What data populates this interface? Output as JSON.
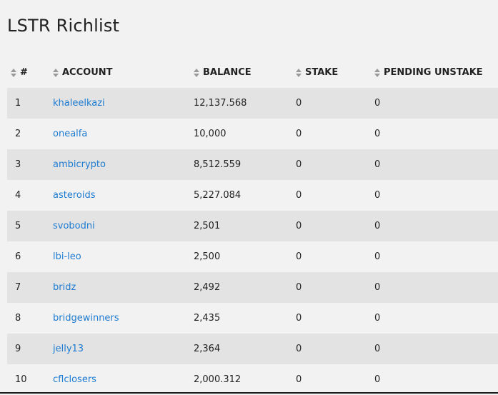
{
  "page": {
    "title": "LSTR Richlist"
  },
  "table": {
    "headers": [
      "#",
      "ACCOUNT",
      "BALANCE",
      "STAKE",
      "PENDING UNSTAKE"
    ],
    "rows": [
      {
        "rank": "1",
        "account": "khaleelkazi",
        "balance": "12,137.568",
        "stake": "0",
        "pending": "0"
      },
      {
        "rank": "2",
        "account": "onealfa",
        "balance": "10,000",
        "stake": "0",
        "pending": "0"
      },
      {
        "rank": "3",
        "account": "ambicrypto",
        "balance": "8,512.559",
        "stake": "0",
        "pending": "0"
      },
      {
        "rank": "4",
        "account": "asteroids",
        "balance": "5,227.084",
        "stake": "0",
        "pending": "0"
      },
      {
        "rank": "5",
        "account": "svobodni",
        "balance": "2,501",
        "stake": "0",
        "pending": "0"
      },
      {
        "rank": "6",
        "account": "lbi-leo",
        "balance": "2,500",
        "stake": "0",
        "pending": "0"
      },
      {
        "rank": "7",
        "account": "bridz",
        "balance": "2,492",
        "stake": "0",
        "pending": "0"
      },
      {
        "rank": "8",
        "account": "bridgewinners",
        "balance": "2,435",
        "stake": "0",
        "pending": "0"
      },
      {
        "rank": "9",
        "account": "jelly13",
        "balance": "2,364",
        "stake": "0",
        "pending": "0"
      },
      {
        "rank": "10",
        "account": "cflclosers",
        "balance": "2,000.312",
        "stake": "0",
        "pending": "0"
      }
    ]
  },
  "colors": {
    "link": "#1e7bd0",
    "row_alt": "#e3e3e3",
    "background": "#f2f2f2",
    "sort_icon": "#9a9a9a"
  },
  "icons": {
    "sort": "sort-icon"
  }
}
